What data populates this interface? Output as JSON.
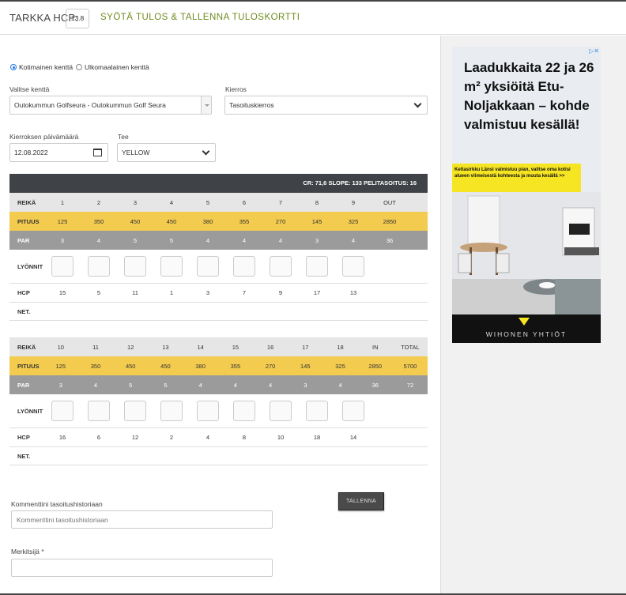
{
  "header": {
    "hcp_label": "TARKKA HCP:",
    "hcp_value": "13.8",
    "title": "SYÖTÄ TULOS & TALLENNA TULOSKORTTI"
  },
  "course_type": {
    "option1": "Kotimainen kenttä",
    "option2": "Ulkomaalainen kenttä",
    "selected": "Kotimainen kenttä"
  },
  "form": {
    "course_label": "Valitse kenttä",
    "course_value": "Outokummun Golfseura - Outokummun Golf Seura",
    "round_label": "Kierros",
    "round_value": "Tasoituskierros",
    "date_label": "Kierroksen päivämäärä",
    "date_value": "12.08.2022",
    "tee_label": "Tee",
    "tee_value": "YELLOW"
  },
  "stats": "CR: 71,6   SLOPE: 133   PELITASOITUS: 16",
  "front": {
    "head": [
      "REIKÄ",
      "1",
      "2",
      "3",
      "4",
      "5",
      "6",
      "7",
      "8",
      "9",
      "OUT"
    ],
    "pituus": [
      "PITUUS",
      "125",
      "350",
      "450",
      "450",
      "380",
      "355",
      "270",
      "145",
      "325",
      "2850"
    ],
    "par": [
      "PAR",
      "3",
      "4",
      "5",
      "5",
      "4",
      "4",
      "4",
      "3",
      "4",
      "36"
    ],
    "lyonnit": "LYÖNNIT",
    "hcp": [
      "HCP",
      "15",
      "5",
      "11",
      "1",
      "3",
      "7",
      "9",
      "17",
      "13"
    ],
    "net": "NET."
  },
  "back": {
    "head": [
      "REIKÄ",
      "10",
      "11",
      "12",
      "13",
      "14",
      "15",
      "16",
      "17",
      "18",
      "IN",
      "TOTAL"
    ],
    "pituus": [
      "PITUUS",
      "125",
      "350",
      "450",
      "450",
      "380",
      "355",
      "270",
      "145",
      "325",
      "2850",
      "5700"
    ],
    "par": [
      "PAR",
      "3",
      "4",
      "5",
      "5",
      "4",
      "4",
      "4",
      "3",
      "4",
      "36",
      "72"
    ],
    "lyonnit": "LYÖNNIT",
    "hcp": [
      "HCP",
      "16",
      "6",
      "12",
      "2",
      "4",
      "8",
      "10",
      "18",
      "14"
    ],
    "net": "NET."
  },
  "save_button": "TALLENNA",
  "comment": {
    "label": "Kommenttini tasoitushistoriaan",
    "placeholder": "Kommenttini tasoitushistoriaan"
  },
  "marker": {
    "label": "Merkitsijä *",
    "value": ""
  },
  "ad": {
    "headline": "Laadukkaita 22 ja 26 m² yksiöitä Etu-Noljakkaan – kohde valmistuu kesällä!",
    "banner": "Keltasirkku Länsi valmistuu pian, valitse oma kotisi alueen viimeisestä kohteesta ja muuta kesällä >>",
    "brand": "WIHONEN YHTIÖT",
    "close": "▷✕"
  }
}
